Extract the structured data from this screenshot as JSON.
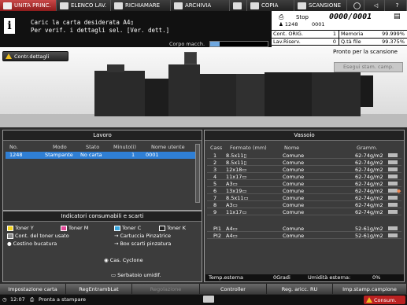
{
  "tabs": [
    {
      "label": "UNITA PRINC.",
      "icon": "home-icon",
      "active": true
    },
    {
      "label": "ELENCO LAV.",
      "icon": "job-list-icon"
    },
    {
      "label": "RICHIAMARE",
      "icon": "recall-icon"
    },
    {
      "label": "ARCHIVIA",
      "icon": "archive-icon"
    },
    {
      "label": "",
      "icon": "dual-page-icon"
    },
    {
      "label": "COPIA",
      "icon": "copy-icon"
    },
    {
      "label": "SCANSIONE",
      "icon": "scan-icon"
    },
    {
      "label": "",
      "icon": "globe-icon"
    },
    {
      "label": "",
      "icon": "speaker-icon"
    },
    {
      "label": "?",
      "icon": "help-icon"
    }
  ],
  "message": {
    "line1": "Caric la carta desiderata    A4▯",
    "line2": "Per verif. i dettagli sel. [Ver. dett.]",
    "corpo_label": "Corpo macch.",
    "corpo_level": 0.16
  },
  "status": {
    "state": "Stop",
    "counter": "0000/0001",
    "job_user": "1248",
    "job_no": "0001",
    "cont_orig_label": "Cont. ORIG.",
    "cont_orig_value": "1",
    "memoria_label": "Memoria",
    "memoria_value": "99.999%",
    "lav_riserv_label": "Lav.Riserv.",
    "lav_riserv_value": "0",
    "qta_file_label": "Q.tà file",
    "qta_file_value": "99.375%"
  },
  "machine": {
    "details_button": "Contr.dettagli",
    "scan_ready": "Pronto per la scansione",
    "esegui_button": "Esegui stam. camp."
  },
  "job_panel": {
    "title": "Lavoro",
    "columns": [
      "No.",
      "Modo",
      "Stato",
      "Minuto(i)",
      "Nome utente"
    ],
    "rows": [
      {
        "no": "1248",
        "modo": "Stampante",
        "stato": "No carta",
        "minuti": "1",
        "utente": "0001"
      }
    ]
  },
  "consumables": {
    "title": "Indicatori consumabili e scarti",
    "items": [
      "Toner Y",
      "Toner M",
      "Toner C",
      "Toner K",
      "Cont. del toner usato",
      "Cartuccia Pinzatrice",
      "Cestino bucatura",
      "Box scarti pinzatura",
      "Cas. Cyclone",
      "Serbatoio umidif."
    ],
    "colors": [
      "#f2d21d",
      "#e44a9a",
      "#3aa8e0",
      "#222222"
    ]
  },
  "trays": {
    "title": "Vassoio",
    "columns": [
      "Cass",
      "Formato (mm)",
      "Nome",
      "Gramm."
    ],
    "rows": [
      {
        "cass": "1",
        "formato": "8.5x11▯",
        "nome": "Comune",
        "gramm": "62-74g/m2"
      },
      {
        "cass": "2",
        "formato": "8.5x11▯",
        "nome": "Comune",
        "gramm": "62-74g/m2"
      },
      {
        "cass": "3",
        "formato": "12x18▭",
        "nome": "Comune",
        "gramm": "62-74g/m2"
      },
      {
        "cass": "4",
        "formato": "11x17▭",
        "nome": "Comune",
        "gramm": "62-74g/m2"
      },
      {
        "cass": "5",
        "formato": "A3▭",
        "nome": "Comune",
        "gramm": "62-74g/m2"
      },
      {
        "cass": "6",
        "formato": "13x19▭",
        "nome": "Comune",
        "gramm": "62-74g/m2",
        "warn": true
      },
      {
        "cass": "7",
        "formato": "8.5x11▭",
        "nome": "Comune",
        "gramm": "62-74g/m2"
      },
      {
        "cass": "8",
        "formato": "A3▭",
        "nome": "Comune",
        "gramm": "62-74g/m2"
      },
      {
        "cass": "9",
        "formato": "11x17▭",
        "nome": "Comune",
        "gramm": "62-74g/m2"
      },
      {
        "cass": "PI1",
        "formato": "A4▭",
        "nome": "Comune",
        "gramm": "52-61g/m2"
      },
      {
        "cass": "PI2",
        "formato": "A4▭",
        "nome": "Comune",
        "gramm": "52-61g/m2"
      }
    ],
    "temp_label": "Temp.esterna",
    "temp_value": "0Gradi",
    "hum_label": "Umidità esterna:",
    "hum_value": "0%"
  },
  "bottom_buttons": [
    "Impostazione carta",
    "RegEntrambLat",
    "Regolazione",
    "Controller",
    "Reg. aricc. RU",
    "Imp.stamp.campione"
  ],
  "footer": {
    "time": "12:07",
    "status": "Pronta a stampare",
    "consum_label": "Consum."
  }
}
